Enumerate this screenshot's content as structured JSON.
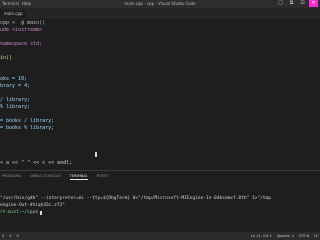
{
  "window": {
    "menu": [
      "Terminal",
      "Help"
    ],
    "title": "main.cpp - cpp - Visual Studio Code",
    "controls": [
      "□",
      "⧉",
      "⊡",
      "✕"
    ]
  },
  "editor": {
    "tab": "main.cpp",
    "lines": [
      "cpp >  @ main()",
      "ude <iostream>",
      "",
      "namespace std;",
      "",
      "in()",
      "",
      "",
      "oks = 10;",
      "brary = 4;",
      "",
      "/ library;",
      "% library;",
      "",
      "= books / library;",
      "= books % library;",
      "",
      "",
      "",
      "",
      "< a << \" \" << c << endl;"
    ]
  },
  "panel": {
    "tabs": [
      "PROBLEMS",
      "DEBUG CONSOLE",
      "TERMINAL",
      "PORTS"
    ],
    "active_tab": "TERMINAL",
    "terminal_lines": [
      "\"/usr/bin/gdb\" --interpreter=mi --tty=${DbgTerm} 0<\"/tmp/Microsoft-MIEngine-In-04bsemxf.0th\" 1>\"/tmp",
      "engine-Out-dhiqh43c.zf3\"",
      "rt-mint:~/cpp$"
    ]
  },
  "status": {
    "left": [
      "0",
      "0",
      "0"
    ],
    "right": [
      "Ln 11, Col 1",
      "Spaces: 4",
      "UTF-8",
      "LF"
    ]
  },
  "colors": {
    "background": "#1e1e1e",
    "text": "#d4d4d4",
    "close_button": "#ff2bd2"
  }
}
